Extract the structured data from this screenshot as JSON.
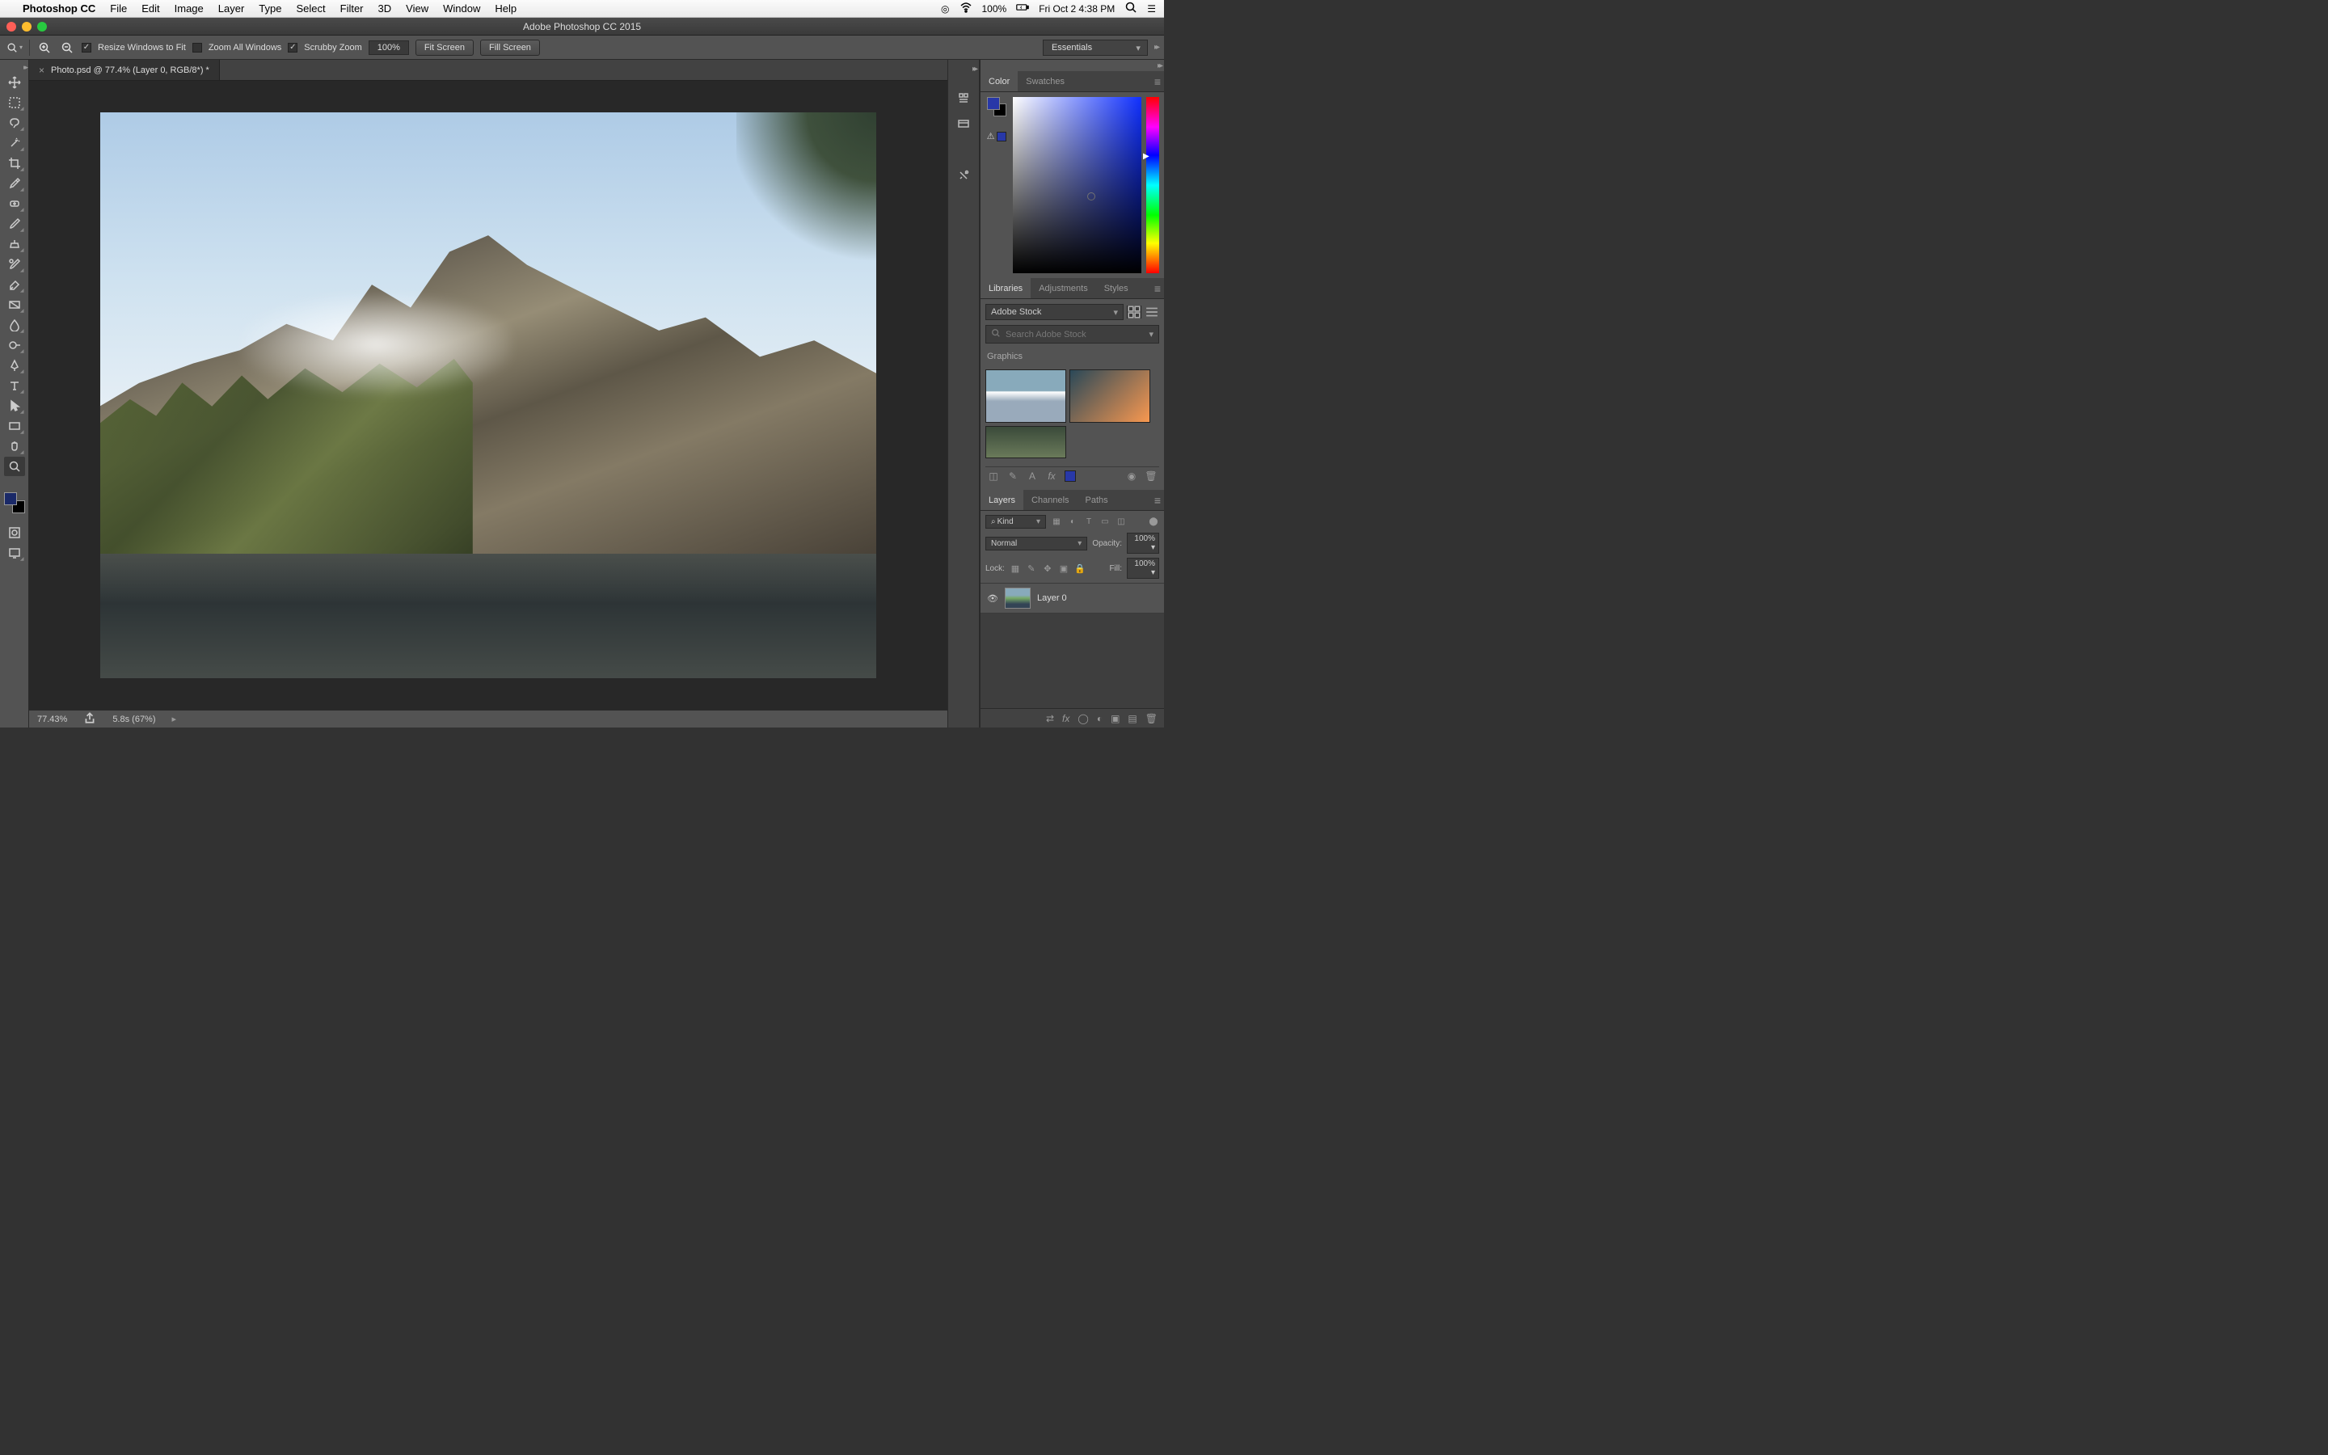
{
  "menubar": {
    "app_name": "Photoshop CC",
    "items": [
      "File",
      "Edit",
      "Image",
      "Layer",
      "Type",
      "Select",
      "Filter",
      "3D",
      "View",
      "Window",
      "Help"
    ],
    "battery": "100%",
    "datetime": "Fri Oct 2  4:38 PM"
  },
  "window": {
    "title": "Adobe Photoshop CC 2015"
  },
  "options": {
    "resize_windows": "Resize Windows to Fit",
    "zoom_all": "Zoom All Windows",
    "scrubby": "Scrubby Zoom",
    "zoom_value": "100%",
    "fit_screen": "Fit Screen",
    "fill_screen": "Fill Screen",
    "workspace": "Essentials"
  },
  "document": {
    "tab_title": "Photo.psd @ 77.4% (Layer 0, RGB/8*) *",
    "status_zoom": "77.43%",
    "status_timing": "5.8s (67%)"
  },
  "panels": {
    "color_tabs": [
      "Color",
      "Swatches"
    ],
    "lib_tabs": [
      "Libraries",
      "Adjustments",
      "Styles"
    ],
    "lib_dropdown": "Adobe Stock",
    "lib_search_placeholder": "Search Adobe Stock",
    "lib_section": "Graphics",
    "layer_tabs": [
      "Layers",
      "Channels",
      "Paths"
    ],
    "layers": {
      "kind": "Kind",
      "blend": "Normal",
      "opacity_label": "Opacity:",
      "opacity_value": "100%",
      "lock_label": "Lock:",
      "fill_label": "Fill:",
      "fill_value": "100%",
      "items": [
        {
          "name": "Layer 0"
        }
      ]
    }
  }
}
